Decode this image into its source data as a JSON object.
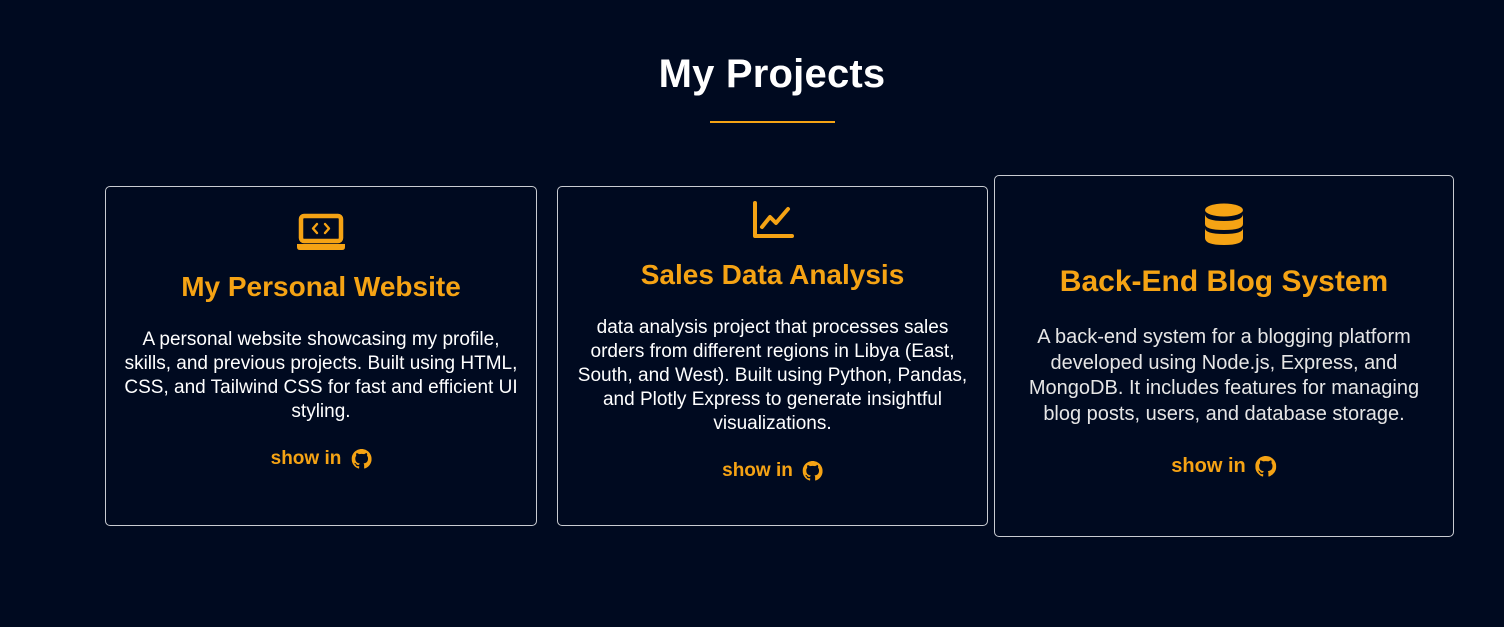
{
  "section": {
    "title": "My Projects"
  },
  "colors": {
    "background": "#000a20",
    "accent": "#f5a314",
    "card_border": "#c9ccd2",
    "text": "#ffffff"
  },
  "projects": [
    {
      "icon": "laptop-code-icon",
      "title": "My Personal Website",
      "description": "A personal website showcasing my profile, skills, and previous projects. Built using HTML, CSS, and Tailwind CSS for fast and efficient UI styling.",
      "link_label": "show in",
      "link_icon": "github-icon"
    },
    {
      "icon": "chart-line-icon",
      "title": "Sales Data Analysis",
      "description": "data analysis project that processes sales orders from different regions in Libya (East, South, and West). Built using Python, Pandas, and Plotly Express to generate insightful visualizations.",
      "link_label": "show in",
      "link_icon": "github-icon"
    },
    {
      "icon": "database-icon",
      "title": "Back-End Blog System",
      "description": "A back-end system for a blogging platform developed using Node.js, Express, and MongoDB. It includes features for managing blog posts, users, and database storage.",
      "link_label": "show in",
      "link_icon": "github-icon"
    }
  ]
}
